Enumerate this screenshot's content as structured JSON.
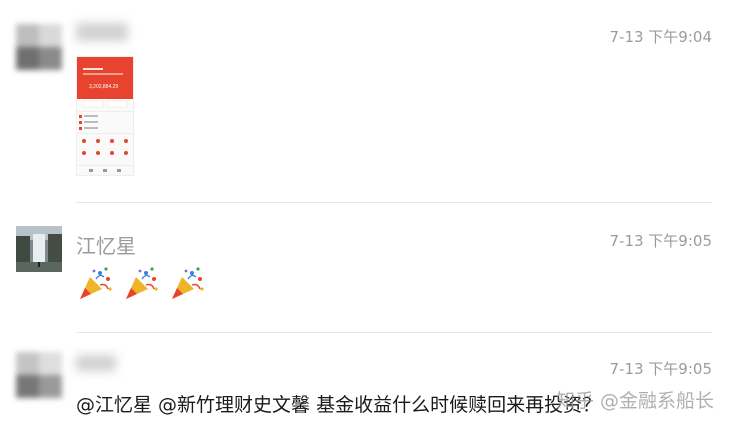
{
  "messages": [
    {
      "time": "7-13 下午9:04"
    },
    {
      "name": "江忆星",
      "time": "7-13 下午9:05",
      "emojis": [
        "party-popper-icon",
        "party-popper-icon",
        "party-popper-icon"
      ]
    },
    {
      "time": "7-13 下午9:05",
      "text": "@江忆星 @新竹理财史文馨 基金收益什么时候赎回来再投资？"
    }
  ],
  "screenshot": {
    "balance": "3,202,884.29"
  },
  "watermark": "知乎 @金融系船长",
  "colors": {
    "accent": "#e8432e",
    "timestamp": "#9b9b9b"
  }
}
